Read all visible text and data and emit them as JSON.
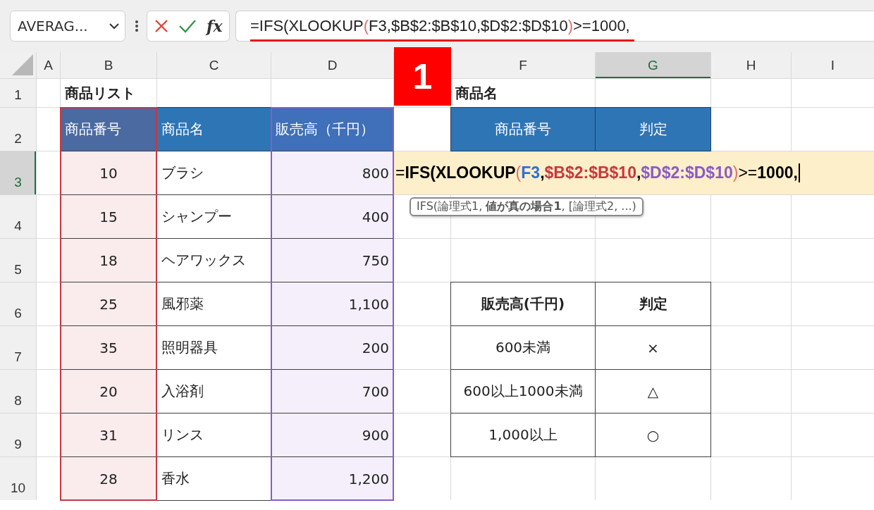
{
  "name_box": {
    "value": "AVERAG..."
  },
  "formula_buttons": {
    "function_label": "fx"
  },
  "formula_bar": {
    "tokens": [
      {
        "text": "=IFS(XLOOKUP",
        "color": "#222222"
      },
      {
        "text": "(",
        "color": "#e07070"
      },
      {
        "text": "F3,$B$2:$B$10,$D$2:$D$10",
        "color": "#222222"
      },
      {
        "text": ")",
        "color": "#e07070"
      },
      {
        "text": ">=1000,",
        "color": "#222222"
      }
    ]
  },
  "callout": {
    "label": "1"
  },
  "column_headers": [
    {
      "label": "A",
      "selected": false
    },
    {
      "label": "B",
      "selected": false
    },
    {
      "label": "C",
      "selected": false
    },
    {
      "label": "D",
      "selected": false
    },
    {
      "label": "F",
      "selected": false
    },
    {
      "label": "G",
      "selected": true
    },
    {
      "label": "H",
      "selected": false
    },
    {
      "label": "I",
      "selected": false
    }
  ],
  "row_headers": [
    {
      "label": "1",
      "selected": false
    },
    {
      "label": "2",
      "selected": false
    },
    {
      "label": "3",
      "selected": true
    },
    {
      "label": "4",
      "selected": false
    },
    {
      "label": "5",
      "selected": false
    },
    {
      "label": "6",
      "selected": false
    },
    {
      "label": "7",
      "selected": false
    },
    {
      "label": "8",
      "selected": false
    },
    {
      "label": "9",
      "selected": false
    },
    {
      "label": "10",
      "selected": false
    }
  ],
  "product_list": {
    "title": "商品リスト",
    "columns": [
      {
        "label": "商品番号",
        "color": "#c8383f"
      },
      {
        "label": "商品名"
      },
      {
        "label": "販売高（千円）",
        "color": "#8c5ac8"
      }
    ],
    "rows": [
      [
        "10",
        "ブラシ",
        "800"
      ],
      [
        "15",
        "シャンプー",
        "400"
      ],
      [
        "18",
        "ヘアワックス",
        "750"
      ],
      [
        "25",
        "風邪薬",
        "1,100"
      ],
      [
        "35",
        "照明器具",
        "200"
      ],
      [
        "20",
        "入浴剤",
        "700"
      ],
      [
        "31",
        "リンス",
        "900"
      ],
      [
        "28",
        "香水",
        "1,200"
      ]
    ]
  },
  "lookup": {
    "title": "商品名",
    "columns": [
      "商品番号",
      "判定"
    ]
  },
  "criteria_table": {
    "columns": [
      "販売高(千円)",
      "判定"
    ],
    "rows": [
      [
        "600未満",
        "×"
      ],
      [
        "600以上1000未満",
        "△"
      ],
      [
        "1,000以上",
        "○"
      ]
    ]
  },
  "cell_editor": {
    "tokens": [
      {
        "text": "=",
        "color": "#000000",
        "bold": false
      },
      {
        "text": "IFS(XLOOKUP",
        "color": "#000000",
        "bold": true
      },
      {
        "text": "(",
        "color": "#e07070",
        "bold": false
      },
      {
        "text": "F3",
        "color": "#2f6fd6",
        "bold": true
      },
      {
        "text": ",",
        "color": "#000000",
        "bold": true
      },
      {
        "text": "$B$2:$B$10",
        "color": "#c8383f",
        "bold": true
      },
      {
        "text": ",",
        "color": "#000000",
        "bold": true
      },
      {
        "text": "$D$2:$D$10",
        "color": "#8c5ac8",
        "bold": true
      },
      {
        "text": ")",
        "color": "#e07070",
        "bold": false
      },
      {
        "text": ">=",
        "color": "#000000",
        "bold": false
      },
      {
        "text": "1000,",
        "color": "#000000",
        "bold": true
      }
    ]
  },
  "tooltip": {
    "text": "IFS(論理式1, **値が真の場合1**, [論理式2, ...)"
  }
}
